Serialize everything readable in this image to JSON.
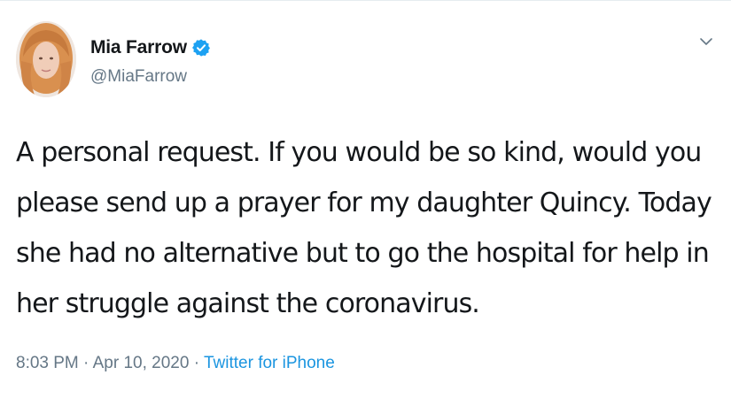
{
  "user": {
    "display_name": "Mia Farrow",
    "handle": "@MiaFarrow",
    "verified": true
  },
  "tweet": {
    "text_lines": [
      "A personal request. If you would be so kind, would you",
      "please send up a prayer for my daughter Quincy. Today",
      "she had no alternative but to go the hospital for help in",
      "her struggle against the coronavirus."
    ]
  },
  "meta": {
    "time": "8:03 PM",
    "date": "Apr 10, 2020",
    "separator": "·",
    "source": "Twitter for iPhone"
  },
  "icons": {
    "verified": "verified-badge-icon",
    "chevron": "chevron-down-icon"
  },
  "colors": {
    "name": "#14171a",
    "secondary": "#657786",
    "link": "#1b95e0",
    "verified": "#1da1f2"
  }
}
